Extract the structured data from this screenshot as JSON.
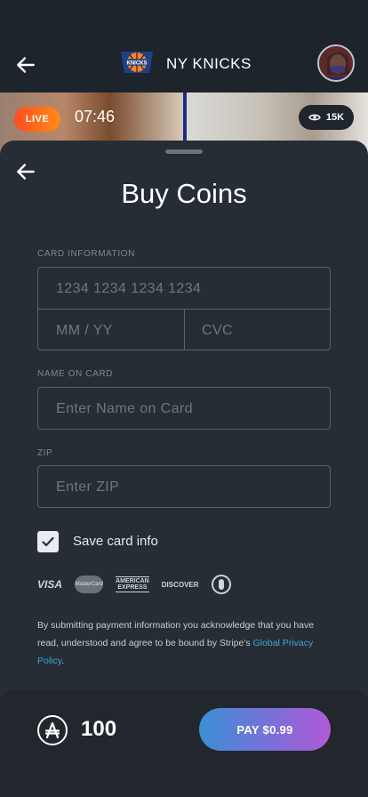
{
  "header": {
    "team_name": "NY KNICKS",
    "team_logo_icon": "knicks-logo-icon",
    "back_icon": "arrow-left-icon"
  },
  "stream": {
    "live_label": "LIVE",
    "elapsed": "07:46",
    "viewers": "15K",
    "viewers_icon": "eye-icon"
  },
  "sheet": {
    "title": "Buy Coins",
    "card_info_label": "CARD INFORMATION",
    "card_number_placeholder": "1234 1234 1234 1234",
    "expiry_placeholder": "MM / YY",
    "cvc_placeholder": "CVC",
    "name_label": "NAME ON CARD",
    "name_placeholder": "Enter Name on Card",
    "zip_label": "ZIP",
    "zip_placeholder": "Enter ZIP",
    "save_card_label": "Save card info",
    "save_card_checked": true,
    "card_brands": [
      "VISA",
      "MasterCard",
      "AMERICAN EXPRESS",
      "DISCOVER",
      "Diners Club"
    ],
    "legal_text": "By submitting payment information you acknowledge that you have read, understood and agree to be bound by Stripe's ",
    "legal_link": "Global Privacy Policy",
    "legal_end": "."
  },
  "footer": {
    "coin_icon": "coin-icon",
    "coin_balance": "100",
    "pay_label": "PAY $0.99"
  },
  "colors": {
    "live_gradient": [
      "#ff4d1e",
      "#ff8b1a"
    ],
    "pay_gradient": [
      "#3a8fd4",
      "#b05ad6"
    ],
    "link": "#3fa3d9",
    "sheet_bg": "#262d35"
  }
}
